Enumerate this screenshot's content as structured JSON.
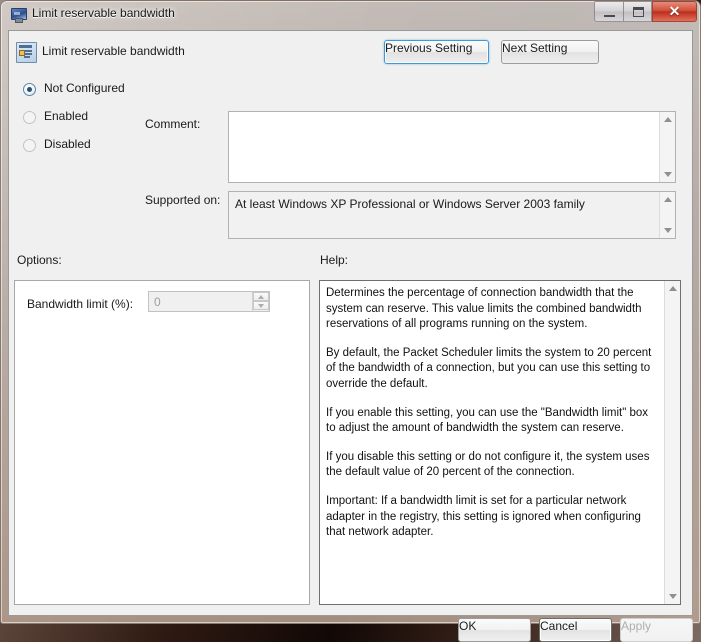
{
  "window": {
    "title": "Limit reservable bandwidth",
    "title_icon": "monitor-icon",
    "controls": {
      "minimize": "minimize-icon",
      "maximize": "maximize-icon",
      "close": "✕"
    }
  },
  "header": {
    "icon": "policy-setting-icon",
    "setting_name": "Limit reservable bandwidth",
    "previous_button": "Previous Setting",
    "next_button": "Next Setting"
  },
  "state": {
    "options": [
      {
        "label": "Not Configured",
        "checked": true,
        "enabled": true
      },
      {
        "label": "Enabled",
        "checked": false,
        "enabled": false
      },
      {
        "label": "Disabled",
        "checked": false,
        "enabled": false
      }
    ]
  },
  "comment": {
    "label": "Comment:",
    "value": ""
  },
  "supported_on": {
    "label": "Supported on:",
    "value": "At least Windows XP Professional or Windows Server 2003 family"
  },
  "options_panel": {
    "label": "Options:",
    "bandwidth_limit_label": "Bandwidth limit (%):",
    "bandwidth_limit_value": "0",
    "bandwidth_limit_enabled": false
  },
  "help_panel": {
    "label": "Help:",
    "paragraphs": [
      "Determines the percentage of connection bandwidth that the system can reserve. This value limits the combined bandwidth reservations of all programs running on the system.",
      "By default, the Packet Scheduler limits the system to 20 percent of the bandwidth of a connection, but you can use this setting to override the default.",
      "If you enable this setting, you can use the \"Bandwidth limit\" box to adjust the amount of bandwidth the system can reserve.",
      "If you disable this setting or do not configure it, the system uses the default value of 20 percent of the connection.",
      "Important: If a bandwidth limit is set for a particular network adapter in the registry, this setting is ignored when configuring that network adapter."
    ]
  },
  "footer": {
    "ok": "OK",
    "cancel": "Cancel",
    "apply": "Apply",
    "apply_enabled": false
  },
  "colors": {
    "close_button": "#bb2f1c",
    "focus_border": "#3c9ad4",
    "client_background": "#f0f0f0"
  }
}
